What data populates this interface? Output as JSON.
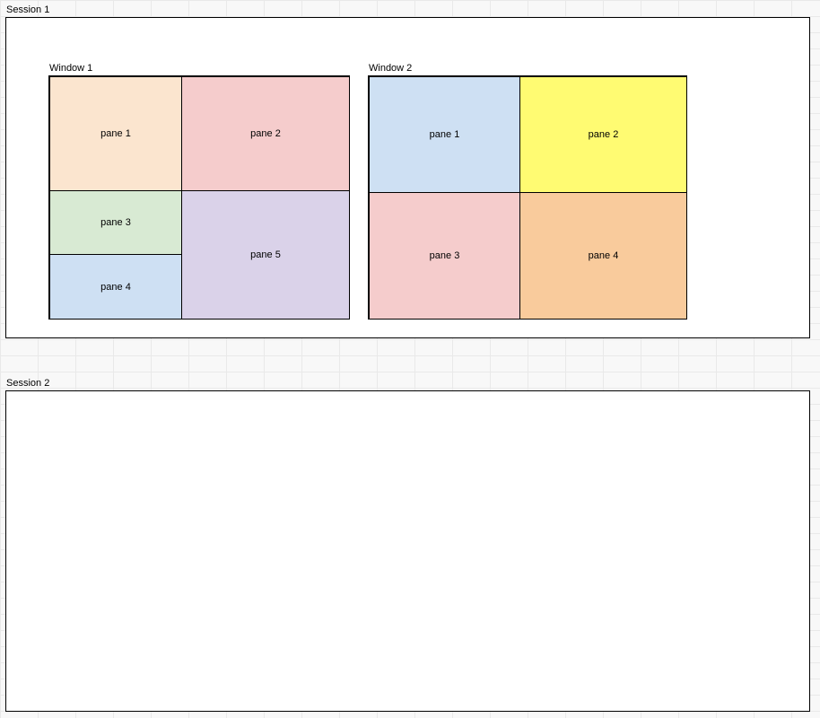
{
  "sessions": [
    {
      "label": "Session 1"
    },
    {
      "label": "Session 2"
    }
  ],
  "windows": [
    {
      "label": "Window 1"
    },
    {
      "label": "Window 2"
    }
  ],
  "w1": {
    "p1": "pane 1",
    "p2": "pane 2",
    "p3": "pane 3",
    "p4": "pane 4",
    "p5": "pane 5"
  },
  "w2": {
    "p1": "pane 1",
    "p2": "pane 2",
    "p3": "pane 3",
    "p4": "pane 4"
  }
}
